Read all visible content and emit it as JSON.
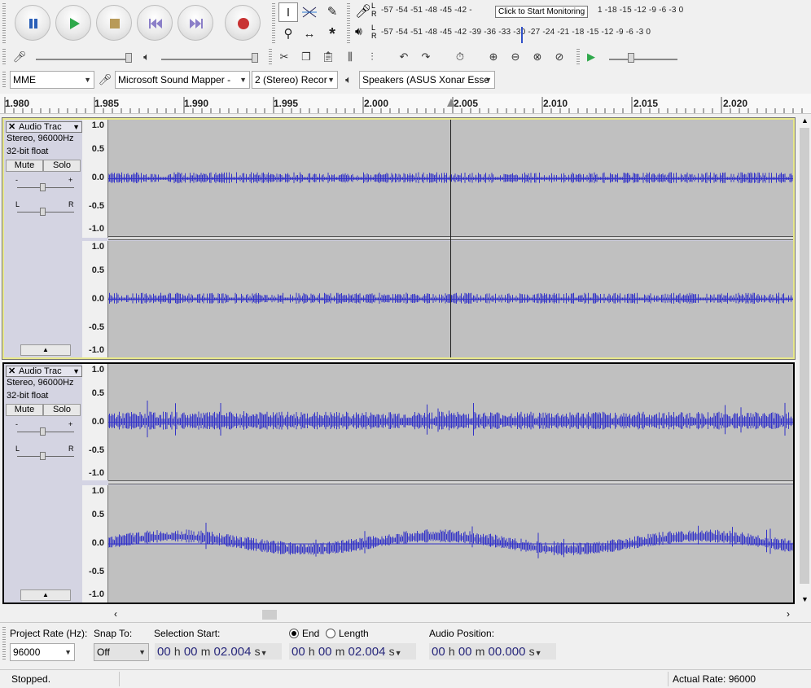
{
  "transport": {
    "pause": "pause-icon",
    "play": "play-icon",
    "stop": "stop-icon",
    "skip_start": "skip-start-icon",
    "skip_end": "skip-end-icon",
    "record": "record-icon"
  },
  "tools": [
    "selection-tool",
    "envelope-tool",
    "draw-tool",
    "zoom-tool",
    "timeshift-tool",
    "multi-tool"
  ],
  "meters": {
    "record_scale": "-57 -54 -51 -48 -45 -42 -",
    "record_scale_right": "1 -18 -15 -12  -9  -6  -3  0",
    "record_tooltip": "Click to Start Monitoring",
    "play_scale": "-57 -54 -51 -48 -45 -42 -39 -36 -33 -30 -27 -24 -21 -18 -15 -12  -9  -6  -3  0",
    "l": "L",
    "r": "R"
  },
  "device": {
    "host": "MME",
    "input": "Microsoft Sound Mapper -",
    "channels": "2 (Stereo) Recor",
    "output": "Speakers (ASUS Xonar Esse"
  },
  "ruler": [
    "1.980",
    "1.985",
    "1.990",
    "1.995",
    "2.000",
    "2.005",
    "2.010",
    "2.015",
    "2.020"
  ],
  "tracks": [
    {
      "name": "Audio Trac",
      "format": "Stereo, 96000Hz",
      "depth": "32-bit float",
      "mute": "Mute",
      "solo": "Solo",
      "gain_l": "-",
      "gain_r": "+",
      "pan_l": "L",
      "pan_r": "R"
    },
    {
      "name": "Audio Trac",
      "format": "Stereo, 96000Hz",
      "depth": "32-bit float",
      "mute": "Mute",
      "solo": "Solo",
      "gain_l": "-",
      "gain_r": "+",
      "pan_l": "L",
      "pan_r": "R"
    }
  ],
  "vruler_labels": [
    "1.0",
    "0.5",
    "0.0",
    "-0.5",
    "-1.0"
  ],
  "selection_bar": {
    "project_rate_label": "Project Rate (Hz):",
    "project_rate": "96000",
    "snap_label": "Snap To:",
    "snap_value": "Off",
    "selection_start_label": "Selection Start:",
    "end_label": "End",
    "length_label": "Length",
    "audio_position_label": "Audio Position:",
    "start_time": {
      "h": "00",
      "m": "00",
      "s": "02.004"
    },
    "end_time": {
      "h": "00",
      "m": "00",
      "s": "02.004"
    },
    "position_time": {
      "h": "00",
      "m": "00",
      "s": "00.000"
    },
    "unit_h": "h",
    "unit_m": "m",
    "unit_s": "s"
  },
  "status": {
    "text": "Stopped.",
    "rate": "Actual Rate: 96000"
  },
  "colors": {
    "waveform": "#3232c8",
    "selected_border": "#e8e88a",
    "wave_bg": "#c0c0c0"
  }
}
